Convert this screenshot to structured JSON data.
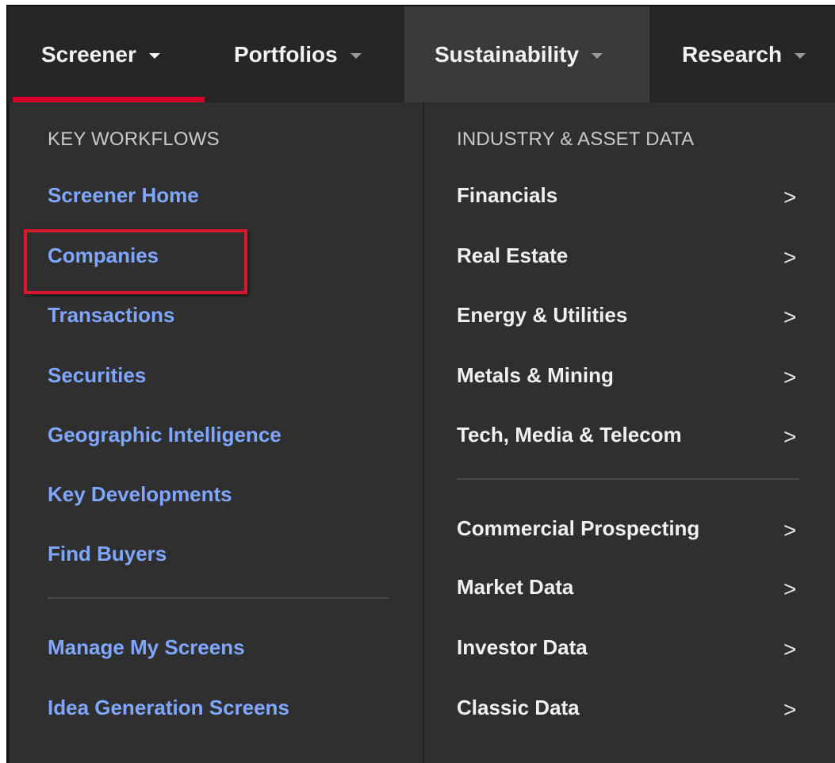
{
  "nav": {
    "items": [
      {
        "label": "Screener"
      },
      {
        "label": "Portfolios"
      },
      {
        "label": "Sustainability"
      },
      {
        "label": "Research"
      }
    ]
  },
  "left": {
    "heading": "KEY WORKFLOWS",
    "links": [
      "Screener Home",
      "Companies",
      "Transactions",
      "Securities",
      "Geographic Intelligence",
      "Key Developments",
      "Find Buyers"
    ],
    "bottom_links": [
      "Manage My Screens",
      "Idea Generation Screens"
    ]
  },
  "right": {
    "heading": "INDUSTRY & ASSET DATA",
    "items": [
      "Financials",
      "Real Estate",
      "Energy & Utilities",
      "Metals & Mining",
      "Tech, Media & Telecom"
    ],
    "bottom_items": [
      "Commercial Prospecting",
      "Market Data",
      "Investor Data",
      "Classic Data"
    ]
  },
  "colors": {
    "link": "#7fa7ff",
    "accent": "#d6002a",
    "panel_bg": "#2f2f2f"
  },
  "icons": {
    "nav_caret": "caret-down-icon",
    "submenu": "chevron-right-icon"
  },
  "highlighted_item": "Companies"
}
